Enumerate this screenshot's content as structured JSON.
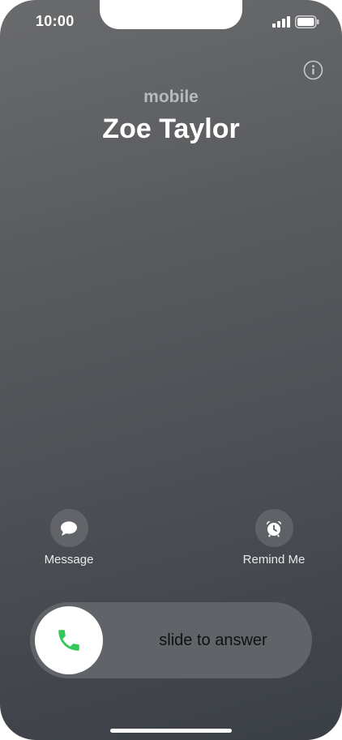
{
  "status_bar": {
    "time": "10:00",
    "icons": [
      "signal-icon",
      "battery-icon"
    ]
  },
  "call": {
    "subtitle": "mobile",
    "caller_name": "Zoe Taylor",
    "info_icon": "info-icon"
  },
  "actions": [
    {
      "label": "Message",
      "icon": "message-icon"
    },
    {
      "label": "Remind Me",
      "icon": "alarm-clock-icon"
    }
  ],
  "slider": {
    "label": "slide to answer",
    "icon": "phone-icon",
    "accent": "#34c759"
  },
  "colors": {
    "background_top": "#6a6b6d",
    "background_bottom": "#3b3f46",
    "slider_track": "#606367"
  }
}
